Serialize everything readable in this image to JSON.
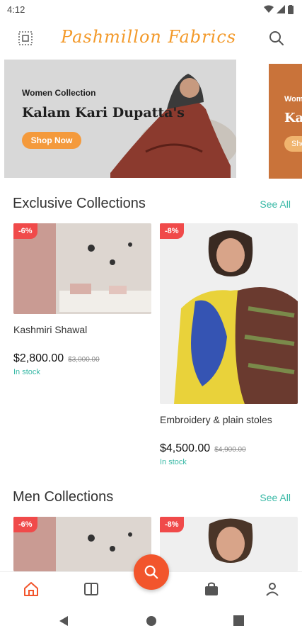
{
  "status_bar": {
    "time": "4:12"
  },
  "header": {
    "logo_text": "Pashmillon Fabrics",
    "menu_icon": "grid-menu-icon",
    "search_icon": "search-icon"
  },
  "banners": [
    {
      "subtitle": "Women Collection",
      "title": "Kalam Kari Dupatta's",
      "button_label": "Shop Now"
    },
    {
      "subtitle": "Wom",
      "title": "Kal",
      "button_label": "Sho"
    }
  ],
  "sections": [
    {
      "title": "Exclusive Collections",
      "see_all": "See All",
      "products": [
        {
          "badge": "-6%",
          "name": "Kashmiri Shawal",
          "price": "$2,800.00",
          "old_price": "$3,000.00",
          "stock": "In stock"
        },
        {
          "badge": "-8%",
          "name": "Embroidery & plain stoles",
          "price": "$4,500.00",
          "old_price": "$4,900.00",
          "stock": "In stock"
        }
      ]
    },
    {
      "title": "Men Collections",
      "see_all": "See All",
      "products": [
        {
          "badge": "-6%"
        },
        {
          "badge": "-8%"
        }
      ]
    }
  ],
  "bottom_nav": {
    "items": [
      "home-icon",
      "book-icon",
      "search-icon",
      "bag-icon",
      "user-icon"
    ],
    "active": "home-icon"
  },
  "colors": {
    "accent": "#f2552c",
    "teal": "#39b9a6",
    "logo": "#f39a2b",
    "badge": "#f04a4a"
  }
}
